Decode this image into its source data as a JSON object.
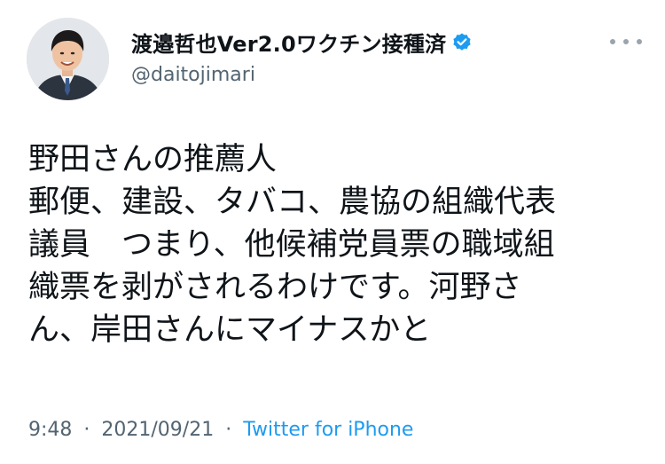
{
  "author": {
    "display_name": "渡邉哲也Ver2.0ワクチン接種済",
    "handle": "@daitojimari",
    "verified": true
  },
  "tweet": {
    "lines": [
      "野田さんの推薦人",
      "郵便、建設、タバコ、農協の組織代表",
      "議員　つまり、他候補党員票の職域組",
      "織票を剥がされるわけです。河野さ",
      "ん、岸田さんにマイナスかと"
    ]
  },
  "meta": {
    "time": "9:48",
    "separator": "·",
    "date": "2021/09/21",
    "source": "Twitter for iPhone"
  },
  "icons": {
    "verified": "verified-badge-icon",
    "more": "more-options-icon"
  },
  "colors": {
    "text": "#0f1419",
    "secondary": "#536471",
    "link": "#1d9bf0"
  }
}
